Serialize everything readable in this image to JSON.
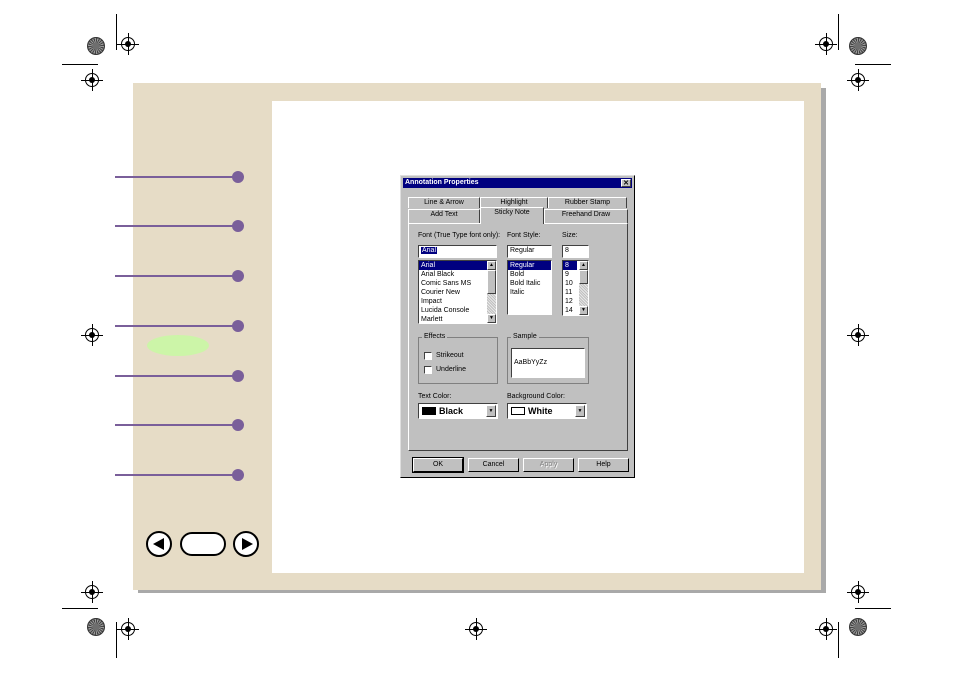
{
  "dialog": {
    "title": "Annotation Properties",
    "close_glyph": "✕",
    "tabs_back": [
      "Line & Arrow",
      "Highlight",
      "Rubber Stamp"
    ],
    "tabs_front": [
      "Add Text",
      "Sticky Note",
      "Freehand Draw"
    ],
    "active_tab": "Sticky Note",
    "font": {
      "label": "Font (True Type font only):",
      "value": "Arial",
      "options": [
        "Arial",
        "Arial Black",
        "Comic Sans MS",
        "Courier New",
        "Impact",
        "Lucida Console",
        "Marlett"
      ],
      "selected": "Arial"
    },
    "font_style": {
      "label": "Font Style:",
      "value": "Regular",
      "options": [
        "Regular",
        "Bold",
        "Bold Italic",
        "Italic"
      ],
      "selected": "Regular"
    },
    "size": {
      "label": "Size:",
      "value": "8",
      "options": [
        "8",
        "9",
        "10",
        "11",
        "12",
        "14"
      ],
      "selected": "8"
    },
    "effects": {
      "title": "Effects",
      "strikeout": "Strikeout",
      "underline": "Underline",
      "strikeout_checked": false,
      "underline_checked": false
    },
    "sample": {
      "title": "Sample",
      "text": "AaBbYyZz"
    },
    "text_color": {
      "label": "Text Color:",
      "value": "Black",
      "swatch": "#000000"
    },
    "background_color": {
      "label": "Background Color:",
      "value": "White",
      "swatch": "#ffffff"
    },
    "buttons": {
      "ok": "OK",
      "cancel": "Cancel",
      "apply": "Apply",
      "help": "Help"
    }
  },
  "colors": {
    "page_bg": "#e6dcc6",
    "callout": "#7a5f9a",
    "highlight_oval": "#ccf5a8",
    "titlebar": "#000080"
  },
  "icons": {
    "nav_prev": "prev-arrow-icon",
    "nav_next": "next-arrow-icon",
    "scroll_up": "▲",
    "scroll_down": "▼",
    "dropdown": "▼"
  }
}
